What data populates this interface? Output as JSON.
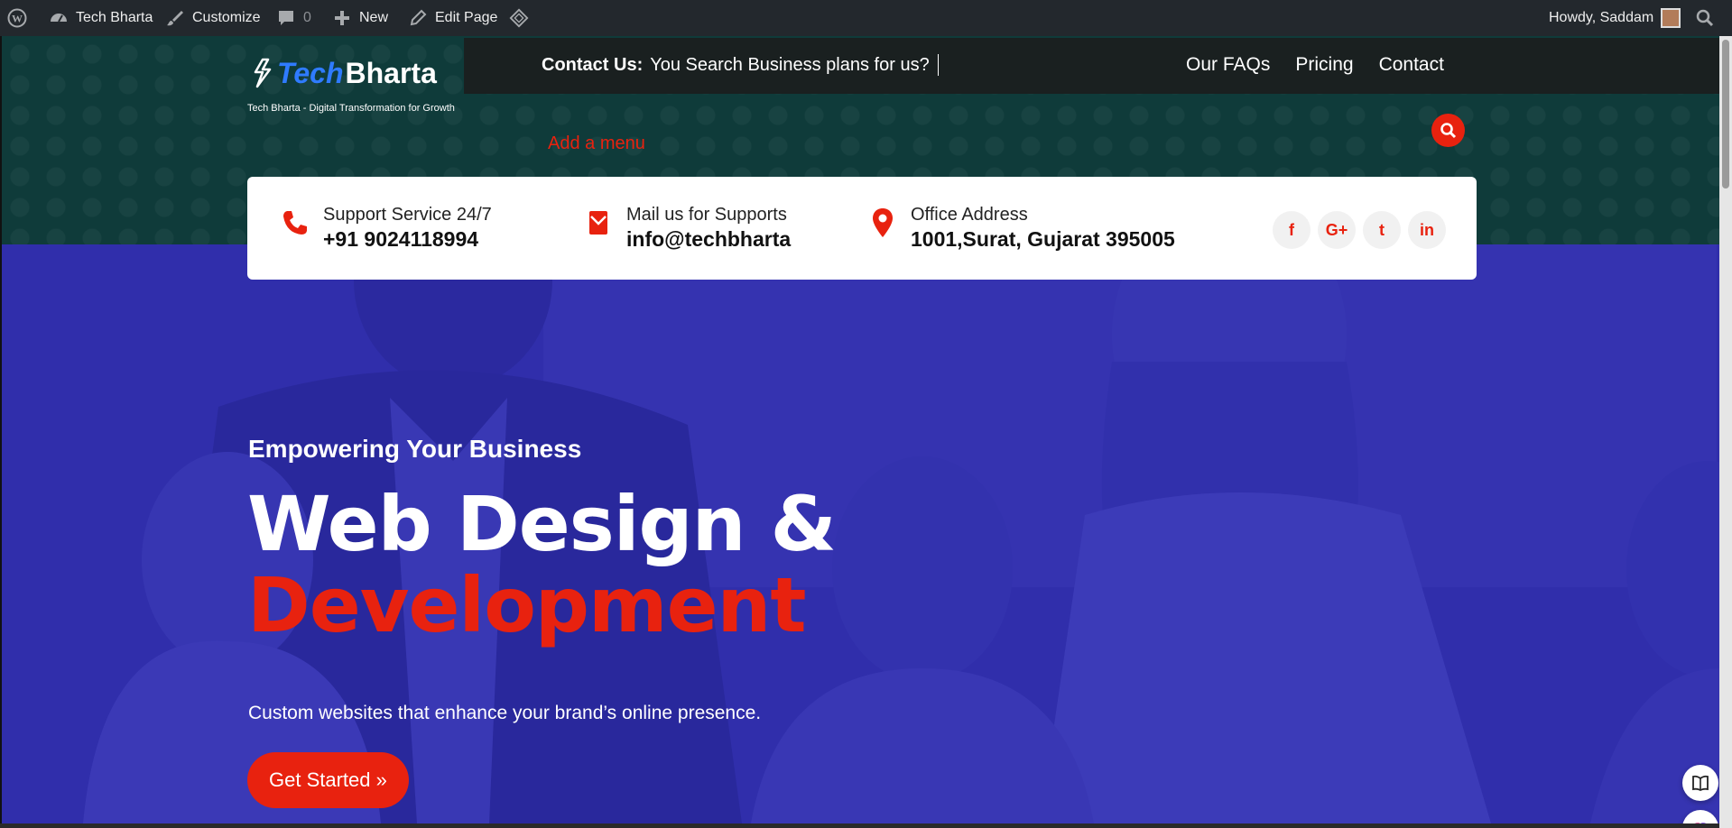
{
  "adminbar": {
    "site": "Tech Bharta",
    "customize": "Customize",
    "comments": "0",
    "new": "New",
    "edit_page": "Edit Page",
    "howdy": "Howdy, Saddam"
  },
  "header": {
    "logo_tech": "Tech",
    "logo_bharta": "Bharta",
    "tagline": "Tech Bharta - Digital Transformation for Growth",
    "contact_label": "Contact Us:",
    "contact_text": "You Search Business plans for us?",
    "nav": [
      "Our FAQs",
      "Pricing",
      "Contact"
    ],
    "add_menu": "Add a menu"
  },
  "info": {
    "support_label": "Support Service 24/7",
    "support_value": "+91 9024118994",
    "mail_label": "Mail us for Supports",
    "mail_value": "info@techbharta",
    "office_label": "Office Address",
    "office_value": "1001,Surat, Gujarat 395005",
    "socials": [
      "f",
      "G+",
      "t",
      "in"
    ]
  },
  "hero": {
    "eyebrow": "Empowering Your Business",
    "title_line1": "Web Design &",
    "title_line2": "Development",
    "subtitle": "Custom websites that enhance your brand’s online presence.",
    "cta": "Get Started »"
  },
  "colors": {
    "accent": "#e8220f",
    "hero_blue": "#3d3cb1",
    "header_teal": "#0f3b3a",
    "admin_bar": "#23282d"
  }
}
